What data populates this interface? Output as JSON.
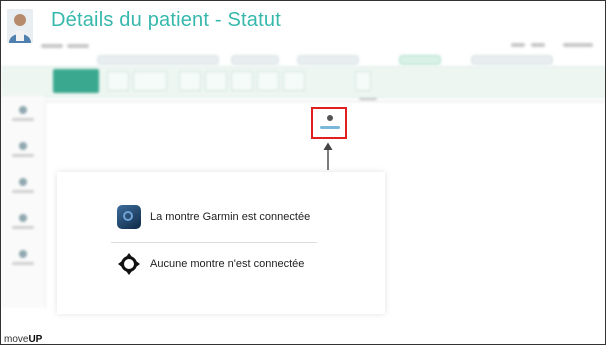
{
  "header": {
    "title": "Détails du patient - Statut"
  },
  "popup": {
    "items": [
      {
        "label": "La montre Garmin est connectée",
        "icon": "garmin-watch-connected-icon"
      },
      {
        "label": "Aucune montre n'est connectée",
        "icon": "no-watch-connected-icon"
      }
    ]
  },
  "brand": {
    "prefix": "move",
    "suffix": "UP"
  },
  "colors": {
    "title": "#37b8ad",
    "highlight": "#e02020",
    "accent": "#3aa88e"
  }
}
